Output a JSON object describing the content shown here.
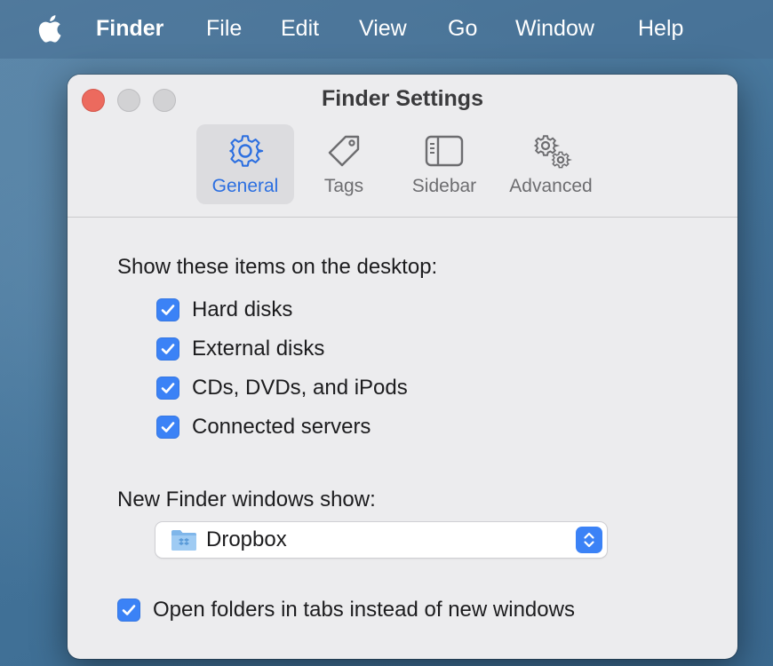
{
  "menubar": {
    "app_name": "Finder",
    "items": [
      "File",
      "Edit",
      "View",
      "Go",
      "Window",
      "Help"
    ]
  },
  "window": {
    "title": "Finder Settings",
    "tabs": [
      {
        "label": "General",
        "icon": "gear-icon",
        "active": true
      },
      {
        "label": "Tags",
        "icon": "tag-icon",
        "active": false
      },
      {
        "label": "Sidebar",
        "icon": "sidebar-icon",
        "active": false
      },
      {
        "label": "Advanced",
        "icon": "gears-icon",
        "active": false
      }
    ]
  },
  "general": {
    "desktop_section_label": "Show these items on the desktop:",
    "desktop_items": [
      {
        "label": "Hard disks",
        "checked": true
      },
      {
        "label": "External disks",
        "checked": true
      },
      {
        "label": "CDs, DVDs, and iPods",
        "checked": true
      },
      {
        "label": "Connected servers",
        "checked": true
      }
    ],
    "new_windows_label": "New Finder windows show:",
    "new_windows_value": "Dropbox",
    "open_in_tabs": {
      "label": "Open folders in tabs instead of new windows",
      "checked": true
    }
  },
  "colors": {
    "accent": "#3b82f6",
    "active_tab_text": "#2c6fe0",
    "close_button": "#ec6a5e"
  }
}
